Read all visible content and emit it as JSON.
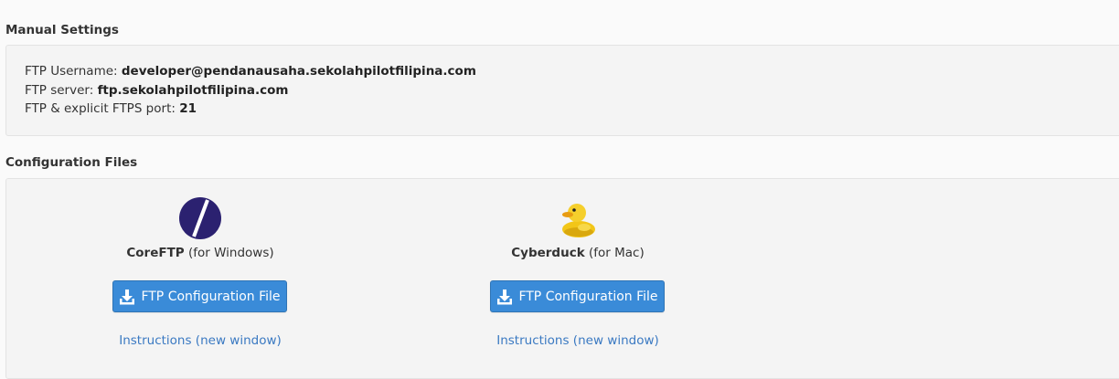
{
  "manual_settings": {
    "heading": "Manual Settings",
    "username_label": "FTP Username:",
    "username_value": "developer@pendanausaha.sekolahpilotfilipina.com",
    "server_label": "FTP server:",
    "server_value": "ftp.sekolahpilotfilipina.com",
    "port_label": "FTP & explicit FTPS port:",
    "port_value": "21"
  },
  "configuration_files": {
    "heading": "Configuration Files",
    "clients": [
      {
        "name": "CoreFTP",
        "platform": "(for Windows)",
        "icon": "coreftp-logo-icon",
        "button_label": "FTP Configuration File",
        "button_icon": "download-icon",
        "instructions_label": "Instructions (new window)"
      },
      {
        "name": "Cyberduck",
        "platform": "(for Mac)",
        "icon": "cyberduck-logo-icon",
        "button_label": "FTP Configuration File",
        "button_icon": "download-icon",
        "instructions_label": "Instructions (new window)"
      }
    ]
  },
  "colors": {
    "button_bg": "#3a8bd8",
    "link": "#3a79c2",
    "coreftp_logo": "#2b2170",
    "cyberduck_logo": "#f2c618"
  }
}
